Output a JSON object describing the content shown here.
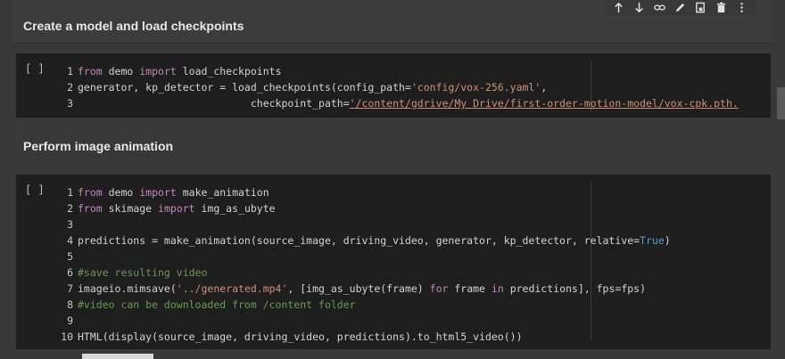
{
  "cell1": {
    "heading": "Create a model and load checkpoints"
  },
  "cell2": {
    "heading": "Perform image animation"
  },
  "toolbar": {
    "icons": [
      "arrow-up-icon",
      "arrow-down-icon",
      "link-icon",
      "edit-icon",
      "mirror-cell-icon",
      "delete-icon",
      "more-icon"
    ]
  },
  "code1": {
    "run_label": "[ ]",
    "lines": [
      {
        "n": "1",
        "segs": [
          {
            "t": "from",
            "c": "kw"
          },
          {
            "t": " demo ",
            "c": "code"
          },
          {
            "t": "import",
            "c": "kw"
          },
          {
            "t": " load_checkpoints",
            "c": "code"
          }
        ]
      },
      {
        "n": "2",
        "segs": [
          {
            "t": "generator, kp_detector = load_checkpoints(config_path=",
            "c": "code"
          },
          {
            "t": "'config/vox-256.yaml'",
            "c": "str"
          },
          {
            "t": ",",
            "c": "code"
          }
        ]
      },
      {
        "n": "3",
        "segs": [
          {
            "t": "                            checkpoint_path=",
            "c": "code"
          },
          {
            "t": "'/content/gdrive/My Drive/first-order-motion-model/vox-cpk.pth.",
            "c": "str under"
          }
        ]
      }
    ]
  },
  "code2": {
    "run_label": "[ ]",
    "lines": [
      {
        "n": "1",
        "segs": [
          {
            "t": "from",
            "c": "kw"
          },
          {
            "t": " demo ",
            "c": "code"
          },
          {
            "t": "import",
            "c": "kw"
          },
          {
            "t": " make_animation",
            "c": "code"
          }
        ]
      },
      {
        "n": "2",
        "segs": [
          {
            "t": "from",
            "c": "kw"
          },
          {
            "t": " skimage ",
            "c": "code"
          },
          {
            "t": "import",
            "c": "kw"
          },
          {
            "t": " img_as_ubyte",
            "c": "code"
          }
        ]
      },
      {
        "n": "3",
        "segs": []
      },
      {
        "n": "4",
        "segs": [
          {
            "t": "predictions = make_animation(source_image, driving_video, generator, kp_detector, relative=",
            "c": "code"
          },
          {
            "t": "True",
            "c": "bool"
          },
          {
            "t": ")",
            "c": "code"
          }
        ]
      },
      {
        "n": "5",
        "segs": []
      },
      {
        "n": "6",
        "segs": [
          {
            "t": "#save resulting video",
            "c": "cm"
          }
        ]
      },
      {
        "n": "7",
        "segs": [
          {
            "t": "imageio.mimsave(",
            "c": "code"
          },
          {
            "t": "'../generated.mp4'",
            "c": "str"
          },
          {
            "t": ", [img_as_ubyte(frame) ",
            "c": "code"
          },
          {
            "t": "for",
            "c": "kw"
          },
          {
            "t": " frame ",
            "c": "code"
          },
          {
            "t": "in",
            "c": "kw"
          },
          {
            "t": " predictions], fps=fps)",
            "c": "code"
          }
        ]
      },
      {
        "n": "8",
        "segs": [
          {
            "t": "#video can be downloaded from /content folder",
            "c": "cm"
          }
        ]
      },
      {
        "n": "9",
        "segs": []
      },
      {
        "n": "10",
        "segs": [
          {
            "t": "HTML(display(source_image, driving_video, predictions).to_html5_video())",
            "c": "code"
          }
        ]
      }
    ]
  }
}
